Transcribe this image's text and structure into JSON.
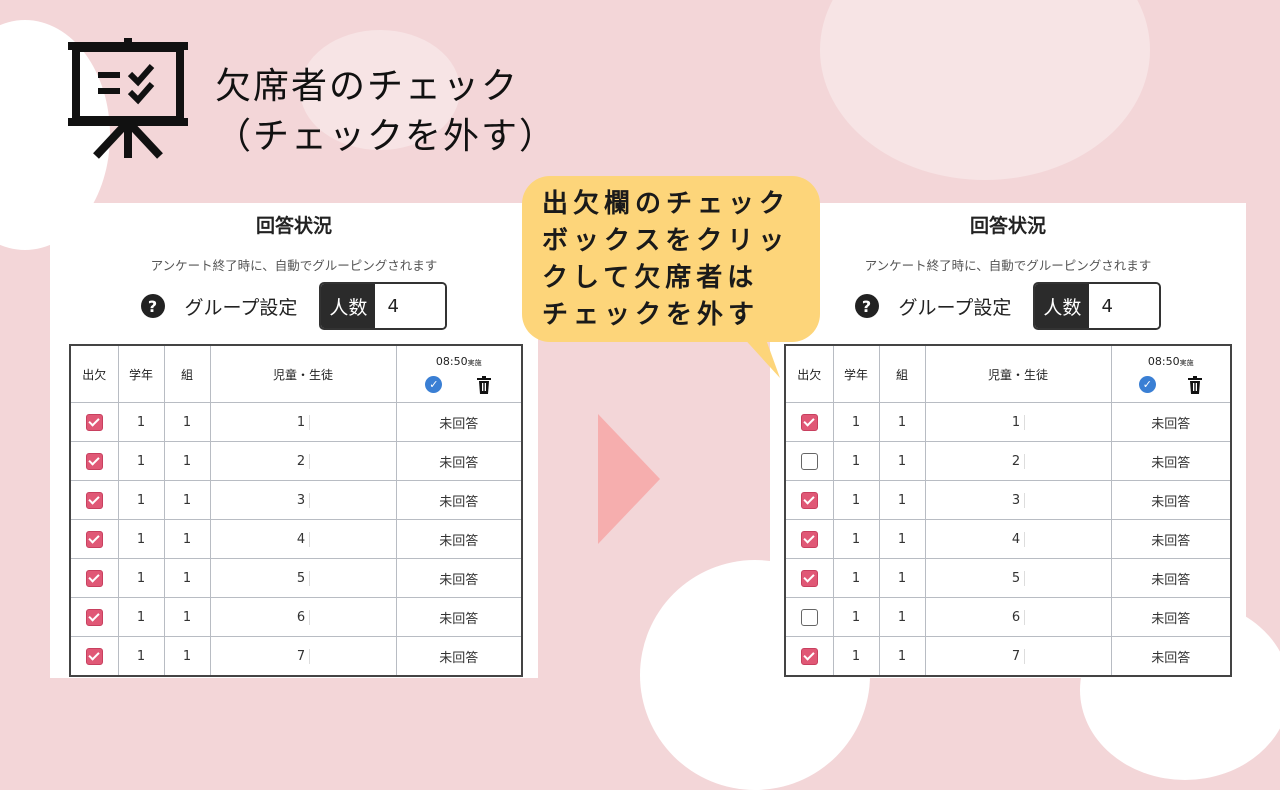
{
  "title": {
    "line1": "欠席者のチェック",
    "line2": "（チェックを外す）"
  },
  "callout": {
    "lines": [
      "出欠欄のチェック",
      "ボックスをクリッ",
      "クして欠席者は",
      "チェックを外す"
    ]
  },
  "icons": {
    "board": "presentation-board-icon",
    "help": "help-circle-icon",
    "check": "check-circle-icon",
    "trash": "trash-icon",
    "arrow": "right-arrow-icon"
  },
  "colors": {
    "background": "#f3d6d8",
    "callout": "#fdd57a",
    "checkbox_on": "#e05876",
    "arrow": "#f6aeae",
    "check_icon": "#3a7fd4"
  },
  "panel": {
    "heading": "回答状況",
    "note": "アンケート終了時に、自動でグルーピングされます",
    "help_glyph": "?",
    "group_label": "グループ設定",
    "count_label": "人数",
    "count_value": "4",
    "columns": [
      "出欠",
      "学年",
      "組",
      "児童・生徒"
    ],
    "time_col": {
      "time": "08:50",
      "suffix": "実施"
    },
    "unanswered": "未回答"
  },
  "before_rows": [
    {
      "checked": true,
      "grade": "1",
      "class": "1",
      "name": "1",
      "answer": "未回答"
    },
    {
      "checked": true,
      "grade": "1",
      "class": "1",
      "name": "2",
      "answer": "未回答"
    },
    {
      "checked": true,
      "grade": "1",
      "class": "1",
      "name": "3",
      "answer": "未回答"
    },
    {
      "checked": true,
      "grade": "1",
      "class": "1",
      "name": "4",
      "answer": "未回答"
    },
    {
      "checked": true,
      "grade": "1",
      "class": "1",
      "name": "5",
      "answer": "未回答"
    },
    {
      "checked": true,
      "grade": "1",
      "class": "1",
      "name": "6",
      "answer": "未回答"
    },
    {
      "checked": true,
      "grade": "1",
      "class": "1",
      "name": "7",
      "answer": "未回答"
    }
  ],
  "after_rows": [
    {
      "checked": true,
      "grade": "1",
      "class": "1",
      "name": "1",
      "answer": "未回答"
    },
    {
      "checked": false,
      "grade": "1",
      "class": "1",
      "name": "2",
      "answer": "未回答"
    },
    {
      "checked": true,
      "grade": "1",
      "class": "1",
      "name": "3",
      "answer": "未回答"
    },
    {
      "checked": true,
      "grade": "1",
      "class": "1",
      "name": "4",
      "answer": "未回答"
    },
    {
      "checked": true,
      "grade": "1",
      "class": "1",
      "name": "5",
      "answer": "未回答"
    },
    {
      "checked": false,
      "grade": "1",
      "class": "1",
      "name": "6",
      "answer": "未回答"
    },
    {
      "checked": true,
      "grade": "1",
      "class": "1",
      "name": "7",
      "answer": "未回答"
    }
  ]
}
